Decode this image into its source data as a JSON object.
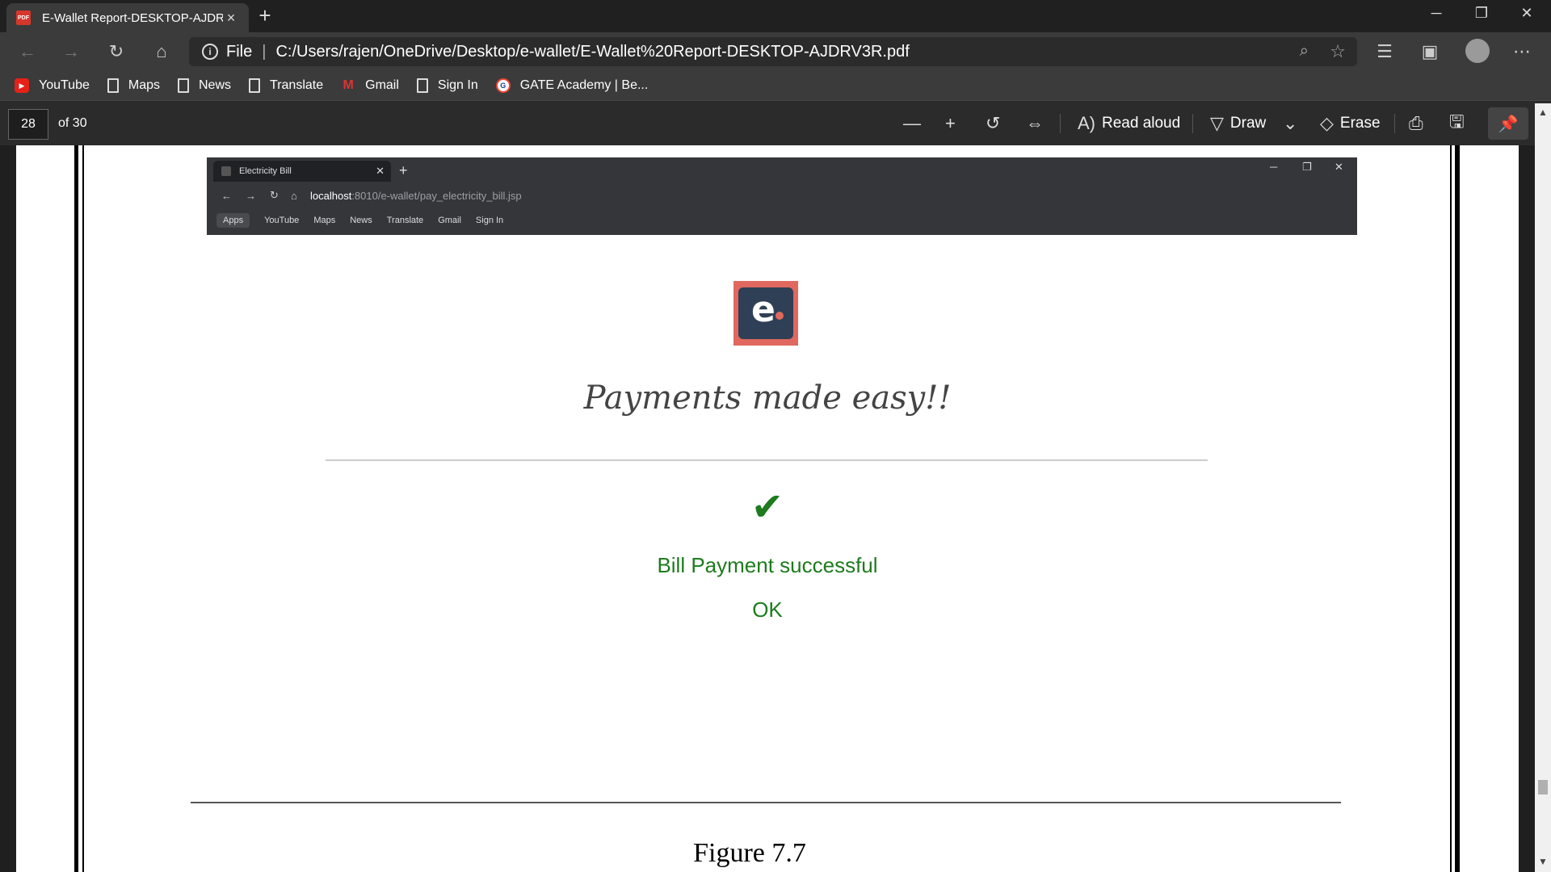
{
  "tab": {
    "title": "E-Wallet Report-DESKTOP-AJDRV3R",
    "icon": "pdf-file-icon"
  },
  "window_controls": {
    "minimize": "─",
    "restore": "❐",
    "close": "✕"
  },
  "address_bar": {
    "scheme_label": "File",
    "url": "C:/Users/rajen/OneDrive/Desktop/e-wallet/E-Wallet%20Report-DESKTOP-AJDRV3R.pdf"
  },
  "bookmarks": [
    {
      "label": "YouTube",
      "icon": "youtube-icon"
    },
    {
      "label": "Maps",
      "icon": "page-icon"
    },
    {
      "label": "News",
      "icon": "page-icon"
    },
    {
      "label": "Translate",
      "icon": "page-icon"
    },
    {
      "label": "Gmail",
      "icon": "gmail-icon"
    },
    {
      "label": "Sign In",
      "icon": "page-icon"
    },
    {
      "label": "GATE Academy | Be...",
      "icon": "gate-academy-icon"
    }
  ],
  "pdf_toolbar": {
    "page_number": "28",
    "page_total": "of 30",
    "read_aloud": "Read aloud",
    "draw": "Draw",
    "erase": "Erase"
  },
  "embedded": {
    "tab_title": "Electricity Bill",
    "url_host": "localhost",
    "url_path": ":8010/e-wallet/pay_electricity_bill.jsp",
    "bookmarks": [
      "Apps",
      "YouTube",
      "Maps",
      "News",
      "Translate",
      "Gmail",
      "Sign In"
    ],
    "logo_letter": "e",
    "tagline": "Payments made easy!!",
    "check": "✔",
    "success_message": "Bill Payment successful",
    "ok_label": "OK"
  },
  "figure_caption": "Figure 7.7",
  "colors": {
    "success_green": "#1e7b1e",
    "logo_red": "#e0685f",
    "logo_navy": "#2f3f55"
  }
}
